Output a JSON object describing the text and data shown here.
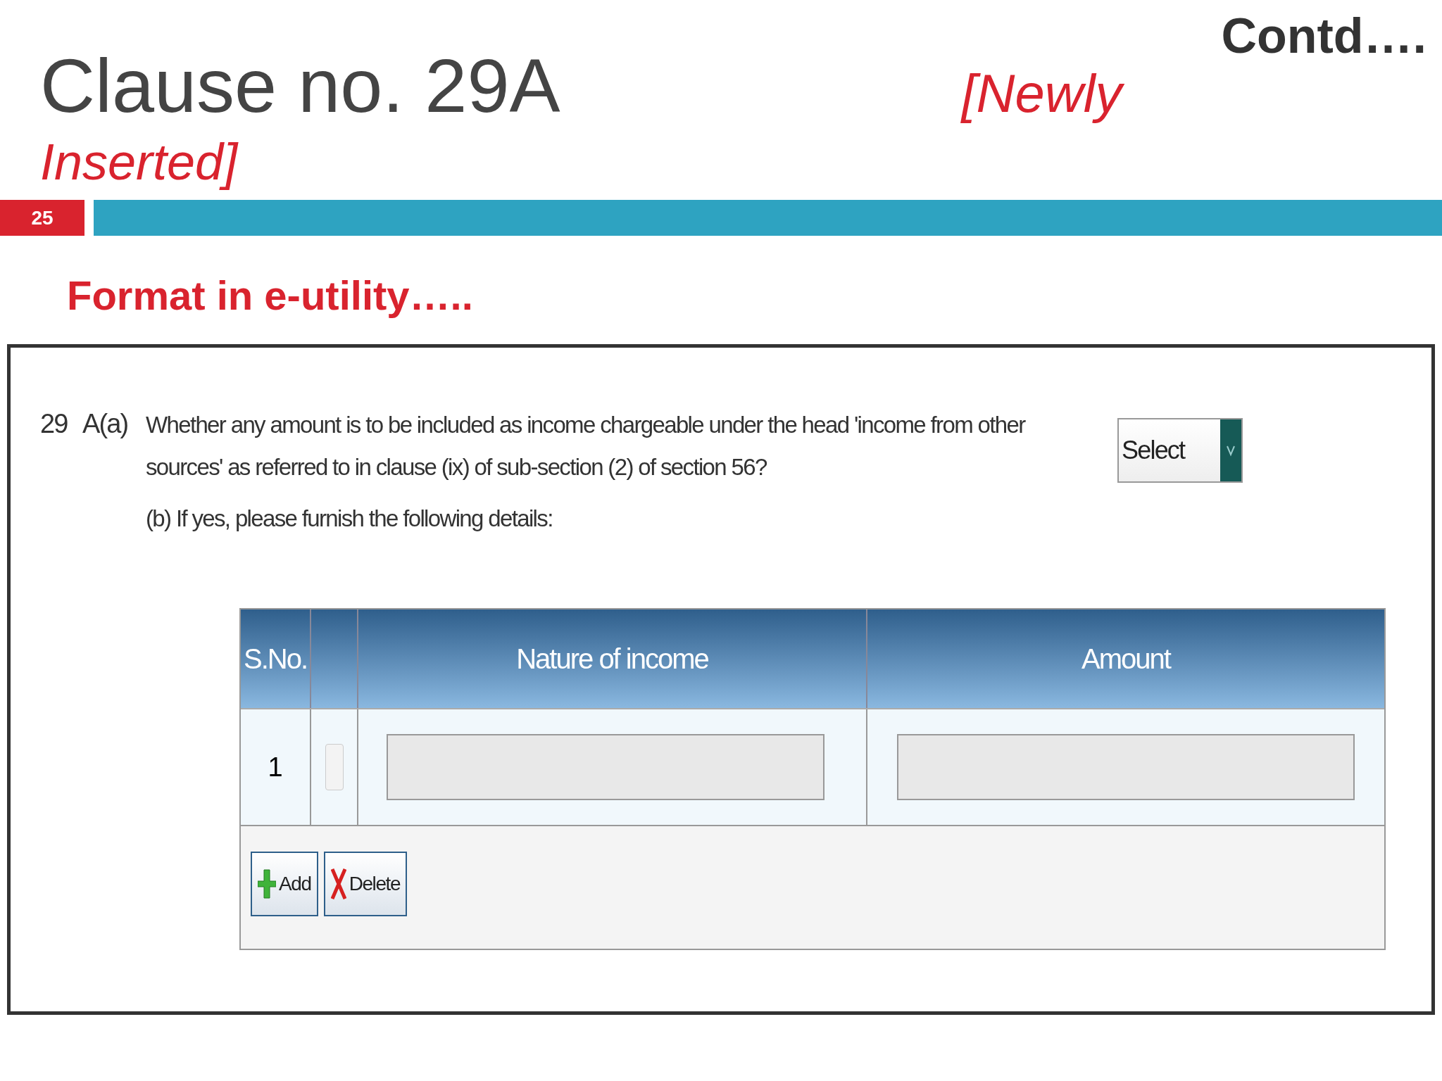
{
  "slide": {
    "title": "Clause no. 29A",
    "title_note_start": "[Newly",
    "title_note_end": "Inserted]",
    "continued": "Contd….",
    "page_number": "25",
    "heading": "Format in e-utility….."
  },
  "form": {
    "clause_number": "29",
    "clause_part": "A(a)",
    "question": "Whether any amount is to be included as income chargeable under the head 'income from other sources' as referred to in clause (ix) of sub-section (2) of section 56?",
    "follow_up": "(b) If yes, please furnish the following details:",
    "select": {
      "value": "Select"
    },
    "table": {
      "columns": [
        "S.No.",
        "Nature of income",
        "Amount"
      ],
      "rows": [
        {
          "sno": "1",
          "checked": false
        }
      ]
    },
    "buttons": [
      {
        "kind": "add",
        "label": "Add"
      },
      {
        "kind": "delete",
        "label": "Delete"
      }
    ]
  }
}
